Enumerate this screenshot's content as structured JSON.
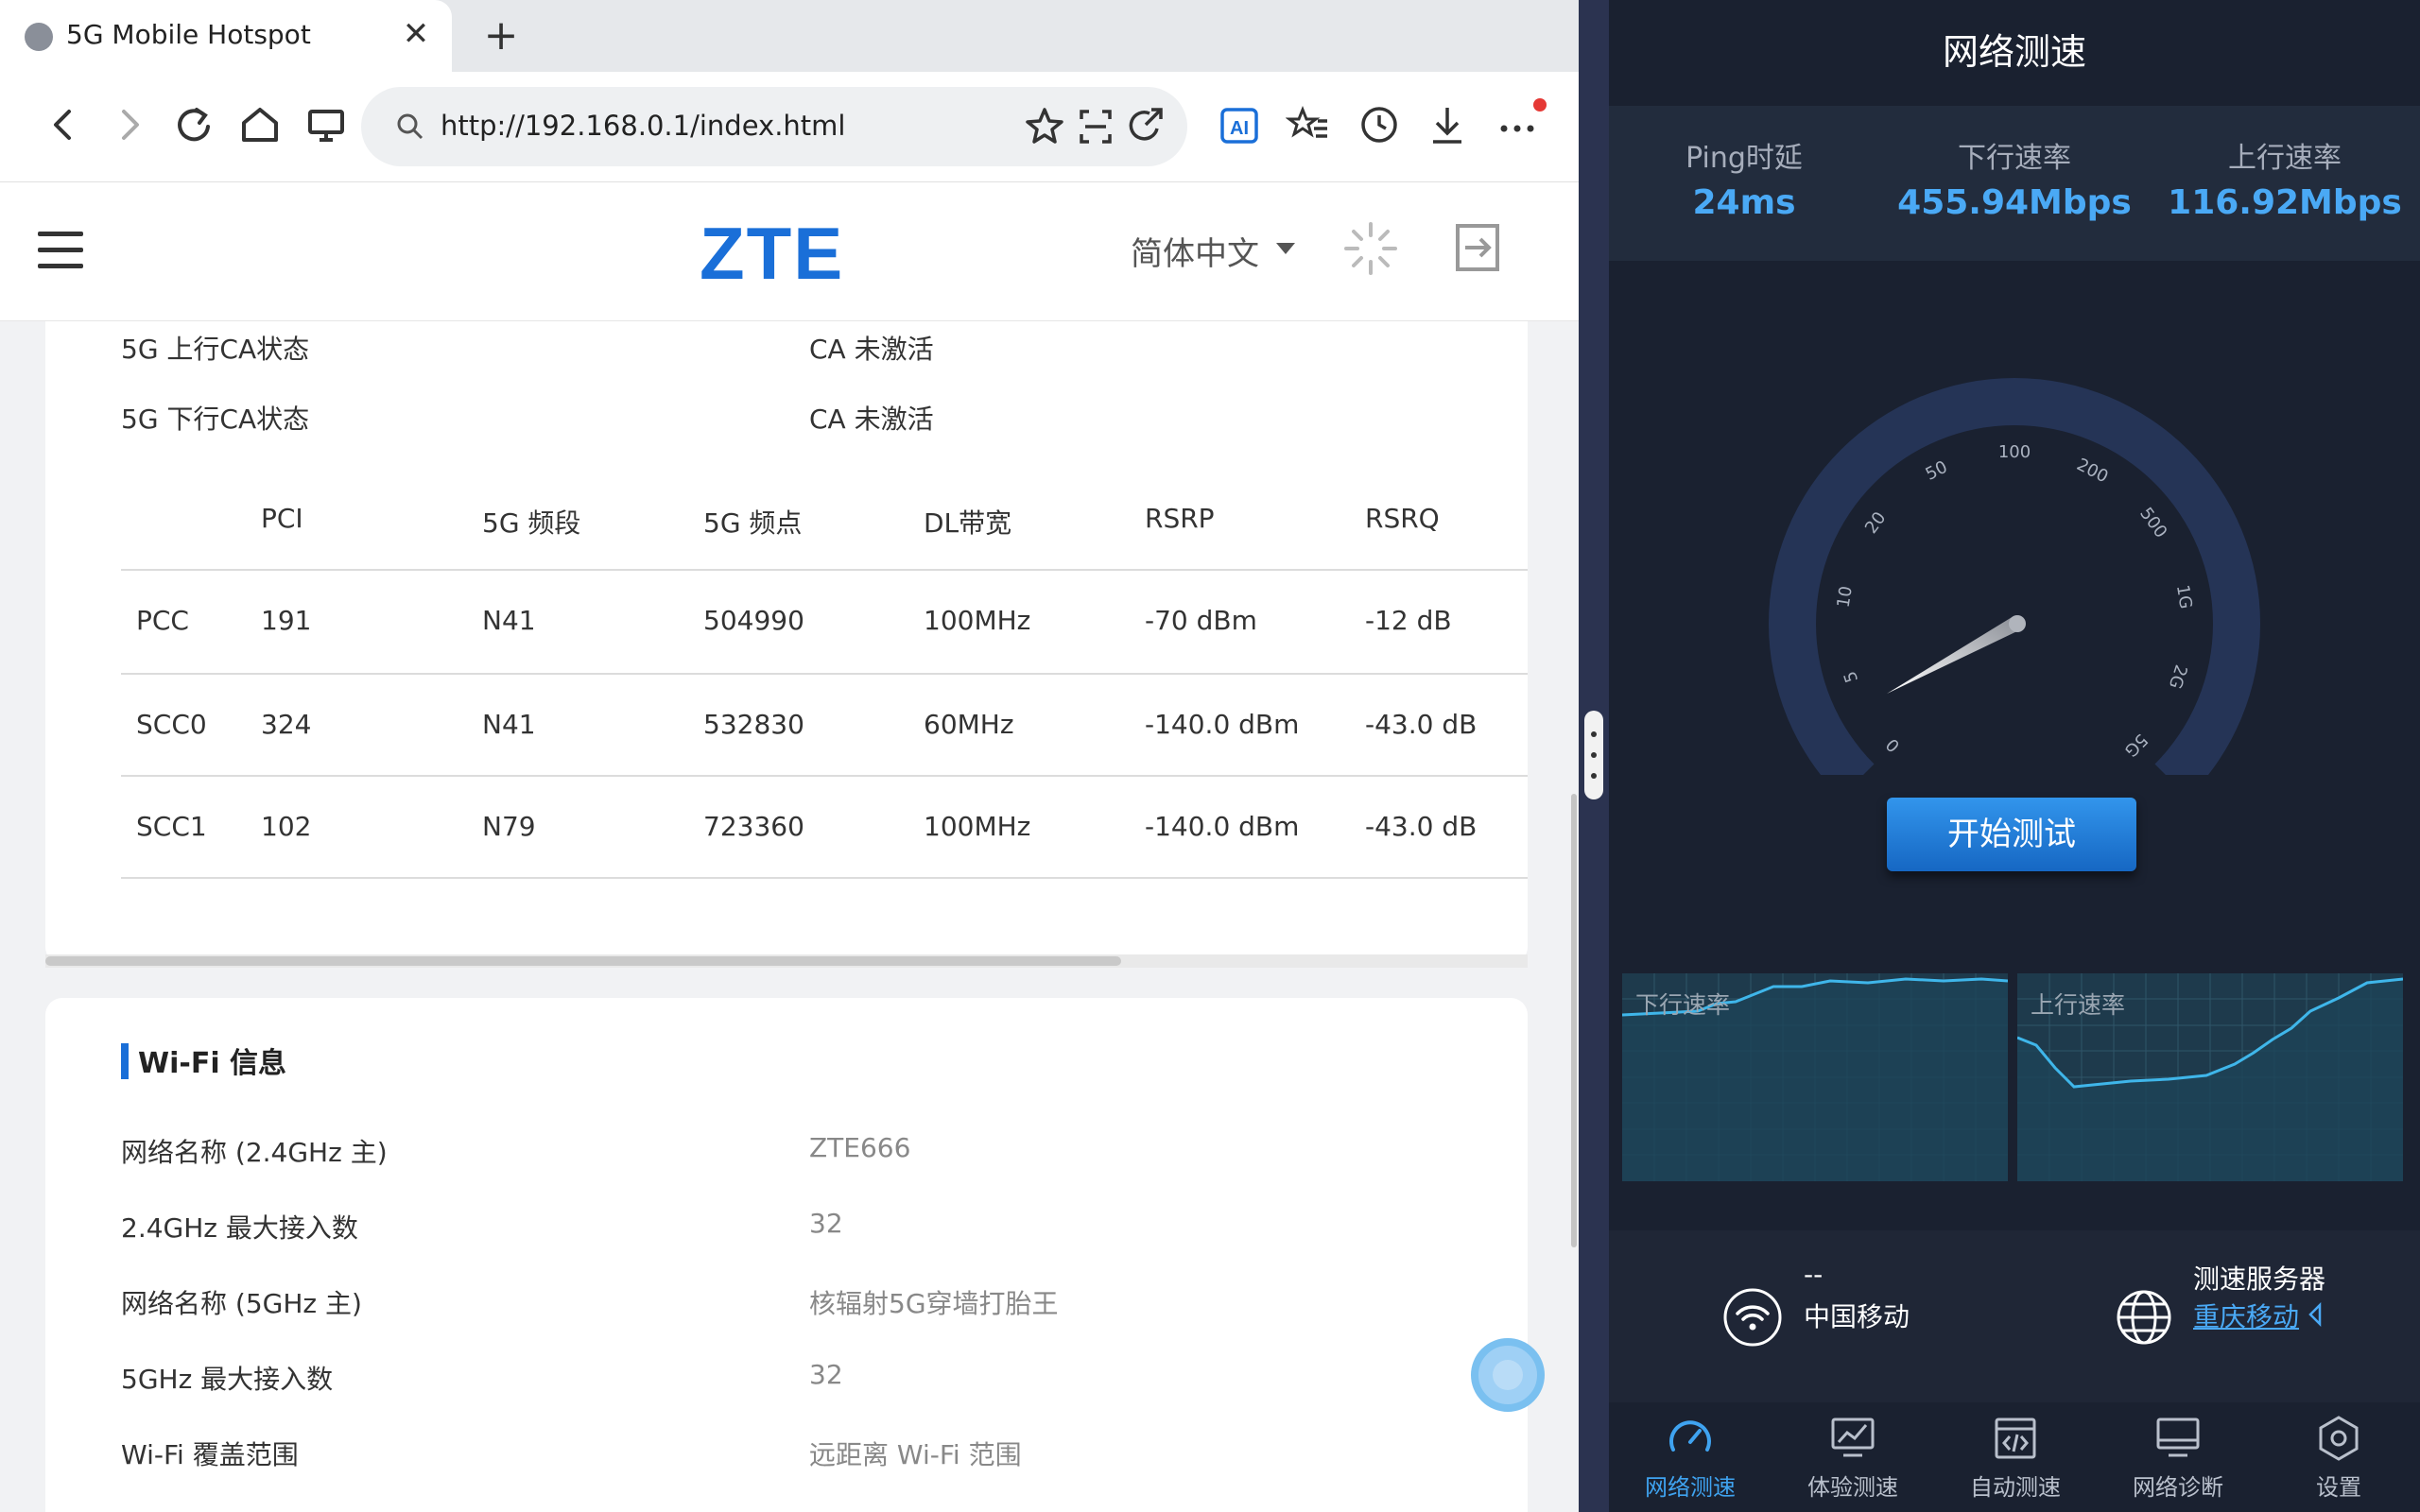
{
  "browser": {
    "tab_title": "5G Mobile Hotspot",
    "tab_close": "✕",
    "new_tab": "+",
    "url": "http://192.168.0.1/index.html"
  },
  "header": {
    "logo": "ZTE",
    "language": "简体中文"
  },
  "ca_status": [
    {
      "label": "5G 上行CA状态",
      "value": "CA 未激活"
    },
    {
      "label": "5G 下行CA状态",
      "value": "CA 未激活"
    }
  ],
  "cell_table": {
    "columns": [
      "PCI",
      "5G 频段",
      "5G 频点",
      "DL带宽",
      "RSRP",
      "RSRQ"
    ],
    "rows": [
      {
        "name": "PCC",
        "cells": [
          "191",
          "N41",
          "504990",
          "100MHz",
          "-70 dBm",
          "-12 dB"
        ]
      },
      {
        "name": "SCC0",
        "cells": [
          "324",
          "N41",
          "532830",
          "60MHz",
          "-140.0 dBm",
          "-43.0 dB"
        ]
      },
      {
        "name": "SCC1",
        "cells": [
          "102",
          "N79",
          "723360",
          "100MHz",
          "-140.0 dBm",
          "-43.0 dB"
        ]
      }
    ]
  },
  "wifi": {
    "title": "Wi-Fi 信息",
    "items": [
      {
        "label": "网络名称 (2.4GHz 主)",
        "value": "ZTE666"
      },
      {
        "label": "2.4GHz 最大接入数",
        "value": "32"
      },
      {
        "label": "网络名称 (5GHz 主)",
        "value": "核辐射5G穿墙打胎王"
      },
      {
        "label": "5GHz 最大接入数",
        "value": "32"
      },
      {
        "label": "Wi-Fi 覆盖范围",
        "value": "远距离 Wi-Fi 范围"
      }
    ]
  },
  "speedtest": {
    "title": "网络测速",
    "ping_label": "Ping时延",
    "ping_value": "24ms",
    "down_label": "下行速率",
    "down_value": "455.94Mbps",
    "up_label": "上行速率",
    "up_value": "116.92Mbps",
    "gauge_ticks": [
      "0",
      "5",
      "10",
      "20",
      "50",
      "100",
      "200",
      "500",
      "1G",
      "2G",
      "5G"
    ],
    "start_button": "开始测试",
    "chart_down_label": "下行速率",
    "chart_up_label": "上行速率",
    "network_name": "--",
    "carrier": "中国移动",
    "server_label": "测速服务器",
    "server_value": "重庆移动",
    "accent_color": "#4aa9f5"
  },
  "nav": [
    {
      "label": "网络测速",
      "icon": "speedometer-icon",
      "active": true
    },
    {
      "label": "体验测速",
      "icon": "chart-monitor-icon",
      "active": false
    },
    {
      "label": "自动测速",
      "icon": "code-window-icon",
      "active": false
    },
    {
      "label": "网络诊断",
      "icon": "monitor-icon",
      "active": false
    },
    {
      "label": "设置",
      "icon": "hexagon-settings-icon",
      "active": false
    }
  ]
}
